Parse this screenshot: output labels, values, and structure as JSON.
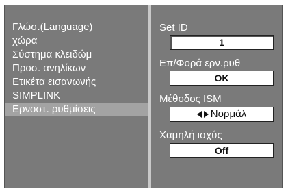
{
  "menu": {
    "items": [
      {
        "label": "Γλώσ.(Language)"
      },
      {
        "label": "χώρα"
      },
      {
        "label": "Σύστημα κλειδώμ"
      },
      {
        "label": "Προσ. ανηλίκων"
      },
      {
        "label": "Ετικέτα εισανωνής"
      },
      {
        "label": "SIMPLINK"
      },
      {
        "label": "Ερνοστ. ρυθμίσεις",
        "selected": true
      }
    ]
  },
  "settings": {
    "set_id": {
      "label": "Set ID",
      "value": "1"
    },
    "reset": {
      "label": "Επ/Φορά ερν.ρυθ",
      "value": "OK"
    },
    "ism": {
      "label": "Μέθοδος ISM",
      "value": "Νορμάλ"
    },
    "low_power": {
      "label": "Χαμηλή ισχύς",
      "value": "Off"
    }
  }
}
